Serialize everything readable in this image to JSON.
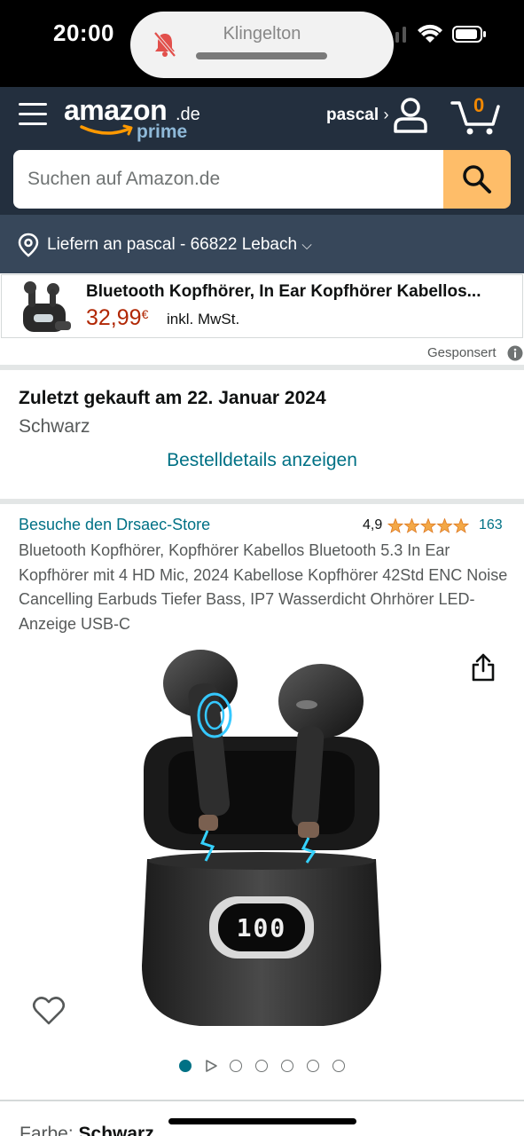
{
  "status_bar": {
    "time": "20:00",
    "island_label": "Klingelton",
    "icons": [
      "bell-muted-icon",
      "signal-icon",
      "wifi-icon",
      "battery-icon"
    ]
  },
  "header": {
    "logo_word": "amazon",
    "logo_tld": ".de",
    "logo_prime": "prime",
    "account_label": "pascal",
    "account_chevron": "›",
    "cart_count": "0",
    "search_placeholder": "Suchen auf Amazon.de"
  },
  "delivery": {
    "text": "Liefern an pascal - 66822 Lebach",
    "chevron": "⌵"
  },
  "sponsored_ad": {
    "title": "Bluetooth Kopfhörer, In Ear Kopfhörer Kabellos...",
    "price": "32,99",
    "currency": "€",
    "tax_note": "inkl. MwSt.",
    "label": "Gesponsert"
  },
  "purchase": {
    "last_bought": "Zuletzt gekauft am 22. Januar 2024",
    "variant": "Schwarz",
    "order_details_link": "Bestelldetails anzeigen"
  },
  "product": {
    "store_link": "Besuche den Drsaec-Store",
    "rating": "4,9",
    "stars_filled": 5,
    "rating_count": "163",
    "title": "Bluetooth Kopfhörer, Kopfhörer Kabellos Bluetooth 5.3 In Ear Kopfhörer mit 4 HD Mic, 2024 Kabellose Kopfhörer 42Std ENC Noise Cancelling Earbuds Tiefer Bass, IP7 Wasserdicht Ohrhörer LED-Anzeige USB-C",
    "case_display": "100",
    "image_count": 7,
    "active_image_index": 0
  },
  "color_selection": {
    "label": "Farbe: ",
    "value": "Schwarz"
  },
  "colors": {
    "header_bg": "#232f3e",
    "delivery_bg": "#37475a",
    "search_button": "#febd69",
    "link": "#007185",
    "price": "#b12704",
    "cart_count": "#f08804",
    "star": "#f3a847"
  }
}
